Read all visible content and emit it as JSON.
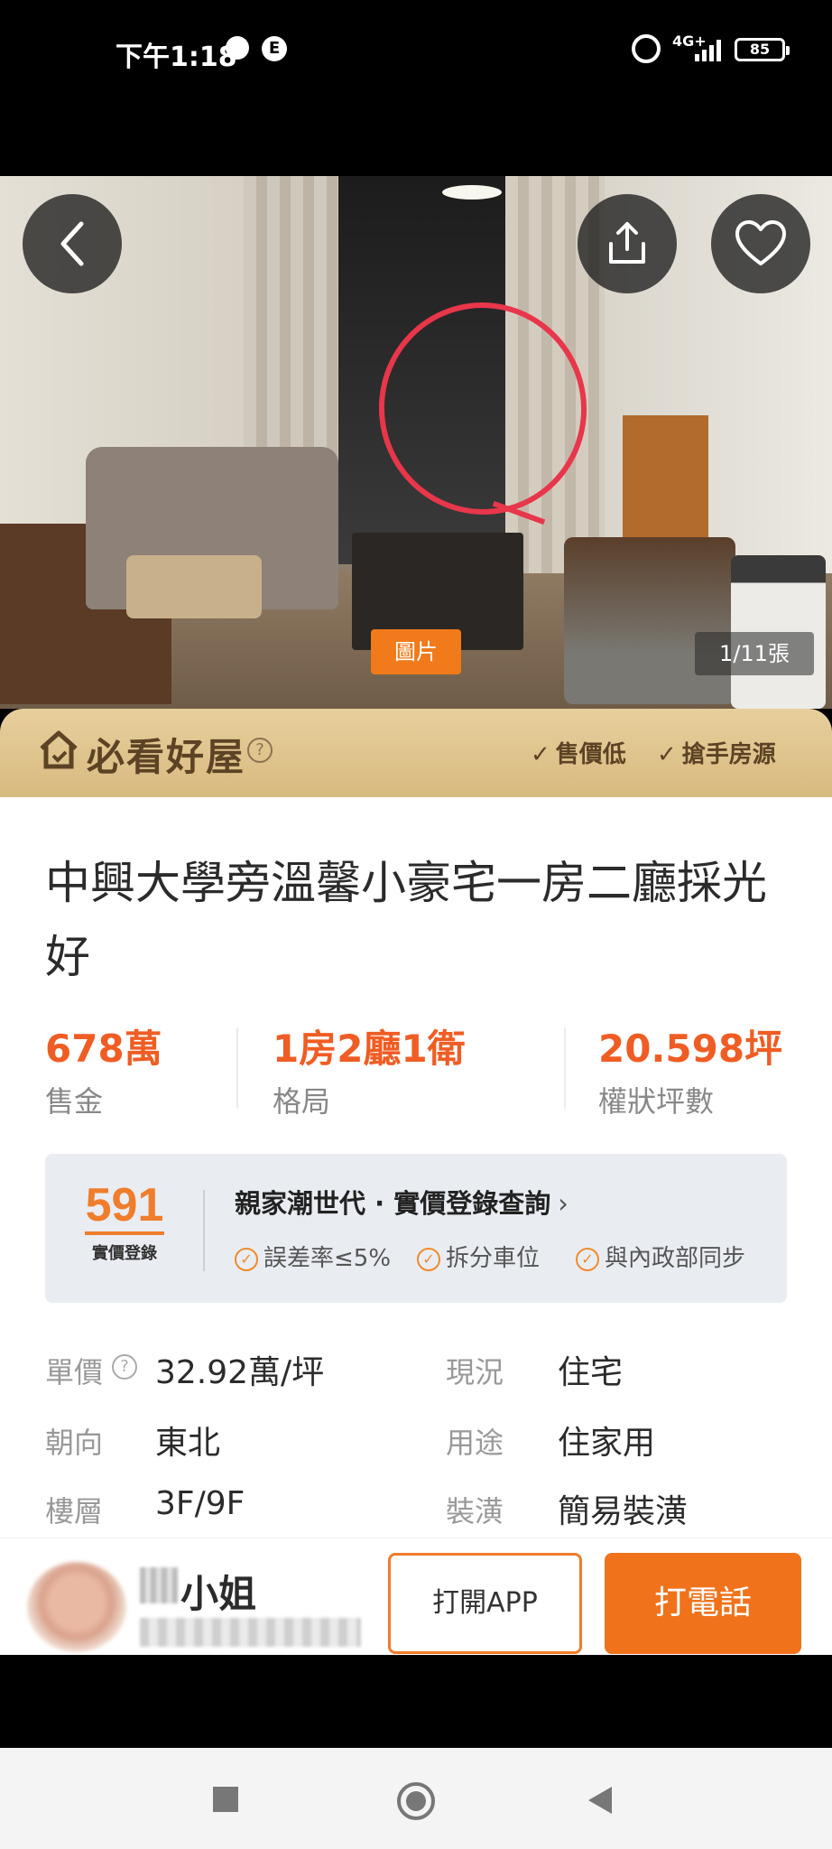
{
  "status_bar": {
    "time": "下午1:18",
    "network": "4G+",
    "battery": "85"
  },
  "hero": {
    "photo_badge": "圖片",
    "photo_counter": "1/11張"
  },
  "banner": {
    "title": "必看好屋",
    "tags": [
      "售價低",
      "搶手房源"
    ]
  },
  "listing": {
    "title": "中興大學旁溫馨小豪宅一房二廳採光好",
    "stats": [
      {
        "value": "678萬",
        "label": "售金"
      },
      {
        "value": "1房2廳1衛",
        "label": "格局"
      },
      {
        "value": "20.598坪",
        "label": "權狀坪數"
      }
    ]
  },
  "price_card": {
    "logo_number": "591",
    "logo_sub": "實價登錄",
    "heading": "親家潮世代 · 實價登錄查詢",
    "features": [
      "誤差率≤5%",
      "拆分車位",
      "與內政部同步"
    ]
  },
  "specs": [
    {
      "label": "單價",
      "value": "32.92萬/坪"
    },
    {
      "label": "現況",
      "value": "住宅"
    },
    {
      "label": "朝向",
      "value": "東北"
    },
    {
      "label": "用途",
      "value": "住家用"
    },
    {
      "label": "樓層",
      "value": "3F/9F"
    },
    {
      "label": "裝潢",
      "value": "簡易裝潢"
    }
  ],
  "contact": {
    "agent_name": "小姐",
    "open_app_label": "打開APP",
    "call_label": "打電話"
  },
  "colors": {
    "accent_orange": "#f0731c",
    "price_orange": "#ef5d24",
    "banner_gold": "#d8ba80",
    "circle_red": "#e8364a"
  }
}
